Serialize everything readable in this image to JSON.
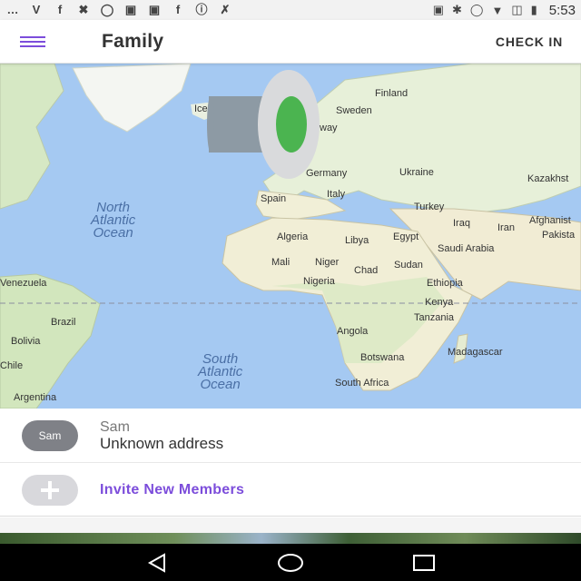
{
  "status_bar": {
    "time": "5:53",
    "icons_left": [
      "message-icon",
      "v-icon",
      "facebook-icon",
      "wrench-icon",
      "alarm-icon",
      "photo-icon",
      "photo-icon",
      "facebook-icon",
      "info-icon",
      "no-location-icon"
    ],
    "icons_right": [
      "lock-icon",
      "bluetooth-icon",
      "alarm-icon",
      "wifi-icon",
      "no-sim-icon",
      "battery-charging-icon"
    ]
  },
  "app_bar": {
    "title": "Family",
    "check_in_label": "CHECK IN"
  },
  "map": {
    "countries": [
      "Finland",
      "Sweden",
      "Ice",
      "way",
      "Germany",
      "Ukraine",
      "Kazakhst",
      "Spain",
      "Italy",
      "Turkey",
      "Iraq",
      "Iran",
      "Afghanist",
      "Pakista",
      "Algeria",
      "Libya",
      "Egypt",
      "Saudi Arabia",
      "Mali",
      "Niger",
      "Chad",
      "Sudan",
      "Nigeria",
      "Ethiopia",
      "Kenya",
      "Tanzania",
      "Angola",
      "Madagascar",
      "Botswana",
      "South Africa",
      "Venezuela",
      "Brazil",
      "Bolivia",
      "Chile",
      "Argentina"
    ],
    "oceans": {
      "north_atlantic": [
        "North",
        "Atlantic",
        "Ocean"
      ],
      "south_atlantic": [
        "South",
        "Atlantic",
        "Ocean"
      ]
    }
  },
  "members": [
    {
      "avatar_initials": "Sam",
      "name": "Sam",
      "address": "Unknown address"
    }
  ],
  "invite": {
    "label": "Invite New Members"
  },
  "colors": {
    "accent": "#7c4ddb",
    "marker_green": "#4caf50",
    "ocean": "#a5c9f2",
    "land": "#e9f1dd"
  }
}
